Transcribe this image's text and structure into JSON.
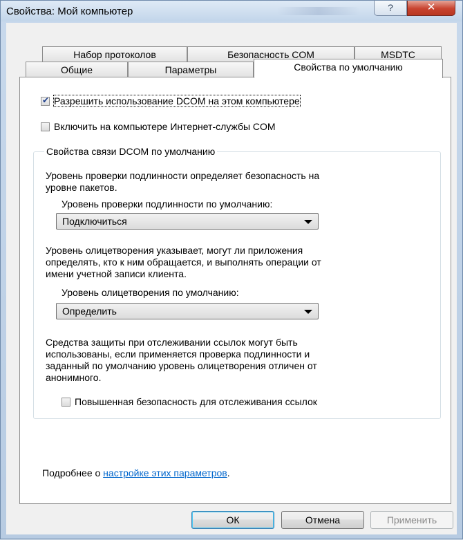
{
  "window": {
    "title": "Свойства: Мой компьютер",
    "help_glyph": "?",
    "close_glyph": "✕"
  },
  "tabs": {
    "row1": [
      "Набор протоколов",
      "Безопасность COM",
      "MSDTC"
    ],
    "row2": [
      "Общие",
      "Параметры",
      "Свойства по умолчанию"
    ],
    "selected": "Свойства по умолчанию"
  },
  "options": {
    "enable_dcom": {
      "label": "Разрешить использование DCOM на этом компьютере",
      "checked": true
    },
    "enable_com_internet": {
      "label": "Включить на компьютере Интернет-службы COM",
      "checked": false
    }
  },
  "group": {
    "title": "Свойства связи DCOM по умолчанию",
    "auth_desc_line1": "Уровень проверки подлинности определяет безопасность на",
    "auth_desc_line2": "уровне пакетов.",
    "auth_label": "Уровень проверки подлинности по умолчанию:",
    "auth_value": "Подключиться",
    "imp_desc_line1": "Уровень олицетворения указывает, могут ли приложения",
    "imp_desc_line2": "определять, кто к ним обращается, и выполнять операции от",
    "imp_desc_line3": "имени учетной записи клиента.",
    "imp_label": "Уровень олицетворения по умолчанию:",
    "imp_value": "Определить",
    "track_desc_line1": "Средства защиты при отслеживании ссылок могут быть",
    "track_desc_line2": "использованы, если применяется проверка подлинности и",
    "track_desc_line3": "заданный по умолчанию уровень олицетворения отличен от",
    "track_desc_line4": "анонимного.",
    "track_label": "Повышенная безопасность для отслеживания ссылок",
    "track_checked": false
  },
  "footer": {
    "more_prefix": "Подробнее о ",
    "more_link": "настройке этих параметров",
    "more_suffix": "."
  },
  "buttons": {
    "ok": "ОК",
    "cancel": "Отмена",
    "apply": "Применить"
  }
}
